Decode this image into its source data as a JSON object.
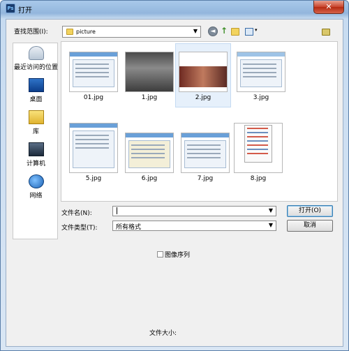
{
  "window": {
    "title": "打开",
    "close_glyph": "✕",
    "app_icon_text": "Ps"
  },
  "toolbar": {
    "lookin_label": "查找范围(I):",
    "lookin_value": "picture",
    "arrow": "▼",
    "back_glyph": "◄",
    "up_glyph": "↑",
    "view_arrow": "▾"
  },
  "places": [
    {
      "label": "最近访问的位置",
      "icon": "recent-places-icon"
    },
    {
      "label": "桌面",
      "icon": "desktop-icon"
    },
    {
      "label": "库",
      "icon": "library-icon"
    },
    {
      "label": "计算机",
      "icon": "computer-icon"
    },
    {
      "label": "网络",
      "icon": "network-icon"
    }
  ],
  "files": [
    {
      "name": "01.jpg"
    },
    {
      "name": "1.jpg"
    },
    {
      "name": "2.jpg",
      "selected": true
    },
    {
      "name": "3.jpg"
    },
    {
      "name": "5.jpg"
    },
    {
      "name": "6.jpg"
    },
    {
      "name": "7.jpg"
    },
    {
      "name": "8.jpg"
    }
  ],
  "form": {
    "filename_label": "文件名(N):",
    "filename_value": "",
    "filetype_label": "文件类型(T):",
    "filetype_value": "所有格式",
    "open_button": "打开(O)",
    "cancel_button": "取消",
    "image_sequence_label": "图像序列",
    "filesize_label": "文件大小:"
  },
  "colors": {
    "title_gradient": "#93b6dd",
    "close": "#c8432b",
    "selected": "#e6f0fb"
  }
}
